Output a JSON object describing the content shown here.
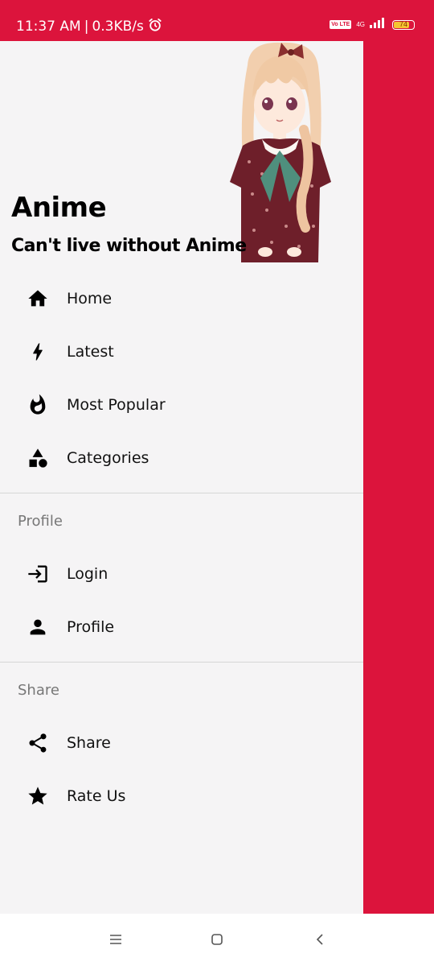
{
  "status_bar": {
    "time": "11:37 AM",
    "separator": "|",
    "speed": "0.3KB/s",
    "volte": "Vo LTE",
    "network": "4G",
    "battery": "74",
    "battery_level": 0.74
  },
  "header": {
    "title": "Anime",
    "subtitle": "Can't live without Anime"
  },
  "menu": {
    "items": [
      {
        "label": "Home",
        "icon": "home-icon"
      },
      {
        "label": "Latest",
        "icon": "bolt-icon"
      },
      {
        "label": "Most Popular",
        "icon": "fire-icon"
      },
      {
        "label": "Categories",
        "icon": "shapes-icon"
      }
    ]
  },
  "profile_section": {
    "title": "Profile",
    "items": [
      {
        "label": "Login",
        "icon": "login-icon"
      },
      {
        "label": "Profile",
        "icon": "person-icon"
      }
    ]
  },
  "share_section": {
    "title": "Share",
    "items": [
      {
        "label": "Share",
        "icon": "share-icon"
      },
      {
        "label": "Rate Us",
        "icon": "star-icon"
      }
    ]
  },
  "colors": {
    "accent": "#dc143c",
    "drawer_bg": "#f5f4f5",
    "section_title": "#777777",
    "divider": "#d6d6d6"
  },
  "nav_bar": {
    "buttons": [
      "menu-icon",
      "home-square-icon",
      "back-icon"
    ]
  }
}
